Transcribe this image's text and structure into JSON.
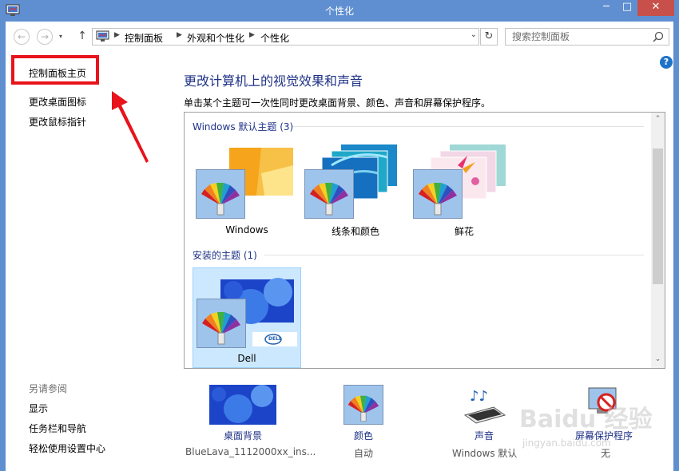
{
  "window": {
    "title": "个性化",
    "min": "─",
    "max": "□",
    "close": "✕"
  },
  "nav": {
    "back": "←",
    "forward": "→",
    "up": "↑",
    "history": "▾"
  },
  "address": {
    "crumbs": [
      "控制面板",
      "外观和个性化",
      "个性化"
    ],
    "dropdown": "⌄",
    "refresh": "↻"
  },
  "search": {
    "placeholder": "搜索控制面板"
  },
  "sidebar": {
    "home": "控制面板主页",
    "links": [
      "更改桌面图标",
      "更改鼠标指针"
    ],
    "see_also_title": "另请参阅",
    "see_also": [
      "显示",
      "任务栏和导航",
      "轻松使用设置中心"
    ]
  },
  "help": "?",
  "main": {
    "heading": "更改计算机上的视觉效果和声音",
    "description": "单击某个主题可一次性同时更改桌面背景、颜色、声音和屏幕保护程序。",
    "groups": [
      {
        "title": "Windows 默认主题 (3)",
        "themes": [
          "Windows",
          "线条和颜色",
          "鲜花"
        ]
      },
      {
        "title": "安装的主题 (1)",
        "themes": [
          "Dell"
        ]
      }
    ],
    "selected_theme": "Dell",
    "dell_logo": "DELL"
  },
  "bottom": {
    "background": {
      "label": "桌面背景",
      "value": "BlueLava_1112000xx_ins..."
    },
    "color": {
      "label": "颜色",
      "value": "自动"
    },
    "sound": {
      "label": "声音",
      "value": "Windows 默认"
    },
    "screensaver": {
      "label": "屏幕保护程序",
      "value": "无"
    }
  },
  "watermark": {
    "text": "Baidu 经验",
    "sub": "jingyan.baidu.com"
  },
  "colors": {
    "titlebar": "#5f8fd0",
    "close": "#c7504a",
    "link": "#1e3287",
    "highlight": "#e8131b",
    "selection": "#cce8ff"
  }
}
